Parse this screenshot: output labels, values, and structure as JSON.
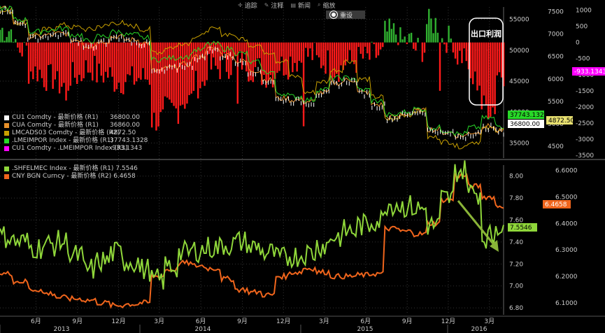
{
  "toolbar": {
    "items": [
      "追踪",
      "注释",
      "新闻",
      "缩放"
    ],
    "reset_label": "重设"
  },
  "annotation": {
    "label": "出口利润"
  },
  "colors": {
    "cu1": "#ffffff",
    "cua": "#e8902a",
    "lmcads": "#c8a000",
    "lmeimpor": "#28d828",
    "diff": "#ff1a1a",
    "diff_pos": "#30b030",
    "shfelmec": "#8fd63a",
    "cny": "#f0651c",
    "arrow": "#8ab438",
    "grid": "#333333",
    "axis_text": "#cccccc"
  },
  "legend_top": [
    {
      "name": "CU1 Comdty - 最新价格 (R1)",
      "value": "36800.00",
      "color": "#ffffff"
    },
    {
      "name": "CUA Comdty - 最新价格 (R1)",
      "value": "36860.00",
      "color": "#e8902a"
    },
    {
      "name": "LMCADS03 Comdty - 最新价格 (R2)",
      "value": "4872.50",
      "color": "#c8a000"
    },
    {
      "name": ".LMEIMPOR Index - 最新价格 (R1)",
      "value": "37743.1328",
      "color": "#28d828"
    },
    {
      "name": "CU1 Comdty - .LMEIMPOR Index (R3)",
      "value": "-933.1343",
      "color": "#ff00ff"
    }
  ],
  "legend_bottom": [
    {
      "name": ".SHFELMEC Index - 最新价格 (R1)",
      "value": "7.5546",
      "color": "#8fd63a"
    },
    {
      "name": "CNY BGN Curncy - 最新价格 (R2)",
      "value": "6.4658",
      "color": "#f0651c"
    }
  ],
  "axis_labels": {
    "top_r1": [
      "55000",
      "50000",
      "45000",
      "40000",
      "35000"
    ],
    "top_r2": [
      "7500",
      "7000",
      "6500",
      "6000",
      "5500",
      "5000",
      "4500"
    ],
    "top_r3": [
      "1000",
      "500",
      "0",
      "-500",
      "-1000",
      "-1500",
      "-2000",
      "-2500",
      "-3000",
      "-3500"
    ],
    "bottom_r1": [
      "8.00",
      "7.80",
      "7.60",
      "7.40",
      "7.20",
      "7.00",
      "6.80"
    ],
    "bottom_r2": [
      "6.6000",
      "6.5000",
      "6.4000",
      "6.3000",
      "6.2000",
      "6.1000"
    ],
    "x_months": [
      "6月",
      "9月",
      "12月",
      "3月",
      "6月",
      "9月",
      "12月",
      "3月",
      "6月",
      "9月",
      "12月",
      "3月"
    ],
    "x_years": [
      "2013",
      "2014",
      "2015",
      "2016"
    ]
  },
  "value_tags": {
    "diff": "-933.1343",
    "cu1": "36800.00",
    "lmcads": "4872.50",
    "shfelmec": "7.5546",
    "cny": "6.4658",
    "lme_partial": "37743.1328"
  },
  "chart_data": [
    {
      "type": "line",
      "title": "",
      "x_axis": {
        "start": "2013-04",
        "end": "2016-04",
        "tick_labels": [
          "6月",
          "9月",
          "12月",
          "3月",
          "6月",
          "9月",
          "12月",
          "3月",
          "6月",
          "9月",
          "12月",
          "3月"
        ],
        "years": [
          "2013",
          "2014",
          "2015",
          "2016"
        ]
      },
      "y_right1_range": [
        33000,
        57000
      ],
      "y_right2_range": [
        4300,
        7600
      ],
      "y_right3_range": [
        -3500,
        1100
      ],
      "series": [
        {
          "name": "CU1 Comdty - 最新价格 (R1)",
          "axis": "R1",
          "color": "#ffffff",
          "last": 36800.0,
          "x": [
            "2013-04",
            "2013-06",
            "2013-08",
            "2013-10",
            "2013-12",
            "2014-02",
            "2014-03",
            "2014-05",
            "2014-07",
            "2014-09",
            "2014-11",
            "2014-12",
            "2015-02",
            "2015-04",
            "2015-05",
            "2015-07",
            "2015-08",
            "2015-10",
            "2015-11",
            "2016-01",
            "2016-02",
            "2016-03",
            "2016-04"
          ],
          "values": [
            56500,
            52000,
            52500,
            50500,
            52000,
            51000,
            46500,
            47500,
            50000,
            48000,
            45000,
            42000,
            41500,
            44500,
            45000,
            41000,
            39000,
            40000,
            37000,
            36000,
            36500,
            37500,
            36800
          ]
        },
        {
          "name": "CUA Comdty - 最新价格 (R1)",
          "axis": "R1",
          "color": "#e8902a",
          "last": 36860.0,
          "x": [
            "2013-04",
            "2013-06",
            "2013-08",
            "2013-10",
            "2013-12",
            "2014-02",
            "2014-03",
            "2014-05",
            "2014-07",
            "2014-09",
            "2014-11",
            "2014-12",
            "2015-02",
            "2015-04",
            "2015-05",
            "2015-07",
            "2015-08",
            "2015-10",
            "2015-11",
            "2016-01",
            "2016-02",
            "2016-03",
            "2016-04"
          ],
          "values": [
            56700,
            52200,
            52700,
            50700,
            52200,
            51200,
            46700,
            47700,
            50200,
            48200,
            45200,
            42200,
            41700,
            44700,
            45200,
            41200,
            39200,
            40200,
            37200,
            36200,
            36700,
            37700,
            36860
          ]
        },
        {
          "name": "LMCADS03 Comdty - 最新价格 (R2)",
          "axis": "R2",
          "color": "#c8a000",
          "last": 4872.5,
          "x": [
            "2013-04",
            "2013-06",
            "2013-08",
            "2013-10",
            "2013-12",
            "2014-02",
            "2014-03",
            "2014-05",
            "2014-07",
            "2014-09",
            "2014-11",
            "2014-12",
            "2015-02",
            "2015-04",
            "2015-05",
            "2015-07",
            "2015-08",
            "2015-10",
            "2015-11",
            "2016-01",
            "2016-02",
            "2016-03",
            "2016-04"
          ],
          "values": [
            7500,
            7000,
            7200,
            7100,
            7250,
            7100,
            6600,
            6800,
            7100,
            6900,
            6600,
            6400,
            5700,
            6200,
            6400,
            5600,
            5100,
            5300,
            4700,
            4500,
            4600,
            4900,
            4872.5
          ]
        },
        {
          "name": ".LMEIMPOR Index - 最新价格 (R1)",
          "axis": "R1",
          "color": "#28d828",
          "last": 37743.1328,
          "x": [
            "2013-04",
            "2013-06",
            "2013-08",
            "2013-10",
            "2013-12",
            "2014-02",
            "2014-03",
            "2014-05",
            "2014-07",
            "2014-09",
            "2014-11",
            "2014-12",
            "2015-02",
            "2015-04",
            "2015-05",
            "2015-07",
            "2015-08",
            "2015-10",
            "2015-11",
            "2016-01",
            "2016-02",
            "2016-03",
            "2016-04"
          ],
          "values": [
            56800,
            53000,
            53500,
            51500,
            53000,
            52000,
            48500,
            49000,
            51000,
            49500,
            46500,
            43000,
            42000,
            45500,
            45500,
            41800,
            39500,
            40500,
            37500,
            36500,
            37500,
            39000,
            37743.1328
          ]
        },
        {
          "name": "CU1 Comdty - .LMEIMPOR Index (R3)",
          "axis": "R3",
          "type": "bar",
          "color": "#ff1a1a",
          "last": -933.1343,
          "x": [
            "2013-04",
            "2013-06",
            "2013-08",
            "2013-10",
            "2013-12",
            "2014-02",
            "2014-03",
            "2014-05",
            "2014-07",
            "2014-09",
            "2014-11",
            "2014-12",
            "2015-02",
            "2015-04",
            "2015-05",
            "2015-07",
            "2015-08",
            "2015-10",
            "2015-11",
            "2016-01",
            "2016-02",
            "2016-03",
            "2016-04"
          ],
          "values": [
            400,
            -900,
            -1300,
            -800,
            -1200,
            -1100,
            -2400,
            -1800,
            -800,
            -600,
            -1000,
            -700,
            -400,
            -800,
            -600,
            -400,
            300,
            -200,
            600,
            -400,
            -1200,
            -2000,
            -933
          ]
        }
      ]
    },
    {
      "type": "line",
      "title": "",
      "y_right1_range": [
        6.75,
        8.1
      ],
      "y_right2_range": [
        6.06,
        6.62
      ],
      "series": [
        {
          "name": ".SHFELMEC Index - 最新价格 (R1)",
          "axis": "R1",
          "color": "#8fd63a",
          "last": 7.5546,
          "x": [
            "2013-04",
            "2013-06",
            "2013-08",
            "2013-10",
            "2013-12",
            "2014-02",
            "2014-03",
            "2014-05",
            "2014-07",
            "2014-09",
            "2014-11",
            "2014-12",
            "2015-02",
            "2015-04",
            "2015-05",
            "2015-07",
            "2015-08",
            "2015-10",
            "2015-11",
            "2016-01",
            "2016-02",
            "2016-03",
            "2016-04"
          ],
          "values": [
            7.45,
            7.35,
            7.4,
            7.15,
            7.3,
            7.15,
            7.05,
            7.3,
            7.35,
            7.4,
            7.3,
            7.25,
            7.3,
            7.45,
            7.5,
            7.6,
            7.75,
            7.7,
            7.55,
            8.05,
            7.85,
            7.45,
            7.5546
          ]
        },
        {
          "name": "CNY BGN Curncy - 最新价格 (R2)",
          "axis": "R2",
          "color": "#f0651c",
          "last": 6.4658,
          "x": [
            "2013-04",
            "2013-06",
            "2013-08",
            "2013-10",
            "2013-12",
            "2014-02",
            "2014-03",
            "2014-05",
            "2014-07",
            "2014-09",
            "2014-11",
            "2014-12",
            "2015-02",
            "2015-04",
            "2015-05",
            "2015-07",
            "2015-08",
            "2015-10",
            "2015-11",
            "2016-01",
            "2016-02",
            "2016-03",
            "2016-04"
          ],
          "values": [
            6.21,
            6.15,
            6.12,
            6.11,
            6.09,
            6.1,
            6.2,
            6.25,
            6.23,
            6.15,
            6.13,
            6.2,
            6.23,
            6.2,
            6.2,
            6.21,
            6.38,
            6.36,
            6.4,
            6.58,
            6.54,
            6.5,
            6.4658
          ]
        }
      ]
    }
  ]
}
